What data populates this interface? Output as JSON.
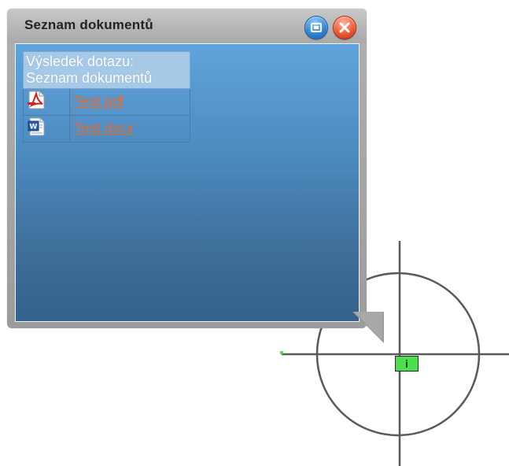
{
  "window": {
    "title": "Seznam dokumentů"
  },
  "table": {
    "header_line1": "Výsledek dotazu:",
    "header_line2": "Seznam dokumentů",
    "rows": [
      {
        "icon": "pdf-file-icon",
        "label": "Test.pdf"
      },
      {
        "icon": "word-file-icon",
        "label": "Test.docx"
      }
    ]
  },
  "marker": {
    "label": "i",
    "color": "#4be04b"
  },
  "colors": {
    "content_top": "#5fa4dc",
    "content_bottom": "#33628c",
    "link": "#e46b2a",
    "header_cell": "#a6c9e8"
  }
}
